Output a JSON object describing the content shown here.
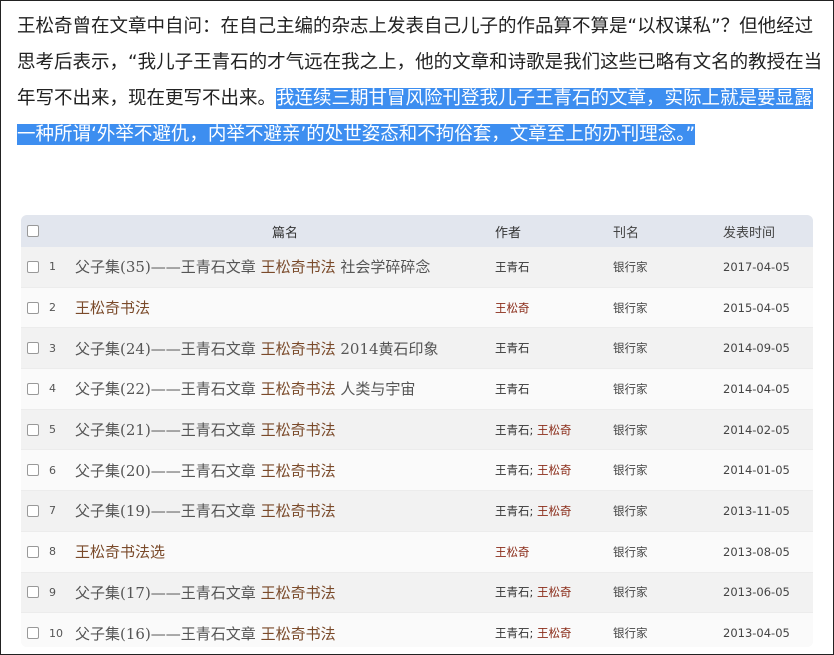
{
  "article": {
    "text_plain": "王松奇曾在文章中自问：在自己主编的杂志上发表自己儿子的作品算不算是“以权谋私”？但他经过思考后表示，“我儿子王青石的才气远在我之上，他的文章和诗歌是我们这些已略有文名的教授在当年写不出来，现在更写不出来。",
    "text_highlighted": "我连续三期甘冒风险刊登我儿子王青石的文章，实际上就是要显露一种所谓‘外举不避仇，内举不避亲’的处世姿态和不拘俗套，文章至上的办刊理念。”",
    "highlight_color": "#3d8ef0"
  },
  "table": {
    "headers": {
      "title": "篇名",
      "author": "作者",
      "journal": "刊名",
      "date": "发表时间"
    },
    "rows": [
      {
        "num": "1",
        "t1": "父子集(35)——王青石文章",
        "t2": "王松奇书法",
        "t3": "社会学碎碎念",
        "author": "王青石",
        "author2": "",
        "journal": "银行家",
        "date": "2017-04-05"
      },
      {
        "num": "2",
        "t1": "",
        "t2": "王松奇书法",
        "t3": "",
        "author": "",
        "author2": "王松奇",
        "journal": "银行家",
        "date": "2015-04-05"
      },
      {
        "num": "3",
        "t1": "父子集(24)——王青石文章",
        "t2": "王松奇书法",
        "t3": "2014黄石印象",
        "author": "王青石",
        "author2": "",
        "journal": "银行家",
        "date": "2014-09-05"
      },
      {
        "num": "4",
        "t1": "父子集(22)——王青石文章",
        "t2": "王松奇书法",
        "t3": "人类与宇宙",
        "author": "王青石",
        "author2": "",
        "journal": "银行家",
        "date": "2014-04-05"
      },
      {
        "num": "5",
        "t1": "父子集(21)——王青石文章",
        "t2": "王松奇书法",
        "t3": "",
        "author": "王青石",
        "author2": "王松奇",
        "journal": "银行家",
        "date": "2014-02-05"
      },
      {
        "num": "6",
        "t1": "父子集(20)——王青石文章",
        "t2": "王松奇书法",
        "t3": "",
        "author": "王青石",
        "author2": "王松奇",
        "journal": "银行家",
        "date": "2014-01-05"
      },
      {
        "num": "7",
        "t1": "父子集(19)——王青石文章",
        "t2": "王松奇书法",
        "t3": "",
        "author": "王青石",
        "author2": "王松奇",
        "journal": "银行家",
        "date": "2013-11-05"
      },
      {
        "num": "8",
        "t1": "",
        "t2": "王松奇书法选",
        "t3": "",
        "author": "",
        "author2": "王松奇",
        "journal": "银行家",
        "date": "2013-08-05"
      },
      {
        "num": "9",
        "t1": "父子集(17)——王青石文章",
        "t2": "王松奇书法",
        "t3": "",
        "author": "王青石",
        "author2": "王松奇",
        "journal": "银行家",
        "date": "2013-06-05"
      },
      {
        "num": "10",
        "t1": "父子集(16)——王青石文章",
        "t2": "王松奇书法",
        "t3": "",
        "author": "王青石",
        "author2": "王松奇",
        "journal": "银行家",
        "date": "2013-04-05"
      }
    ]
  },
  "colors": {
    "author_red": "#8b2d1a",
    "title_brown": "#7a4a2a",
    "header_bg": "#e2e6ee"
  }
}
